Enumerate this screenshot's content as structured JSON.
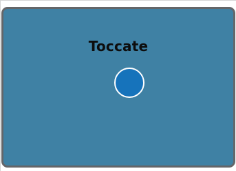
{
  "panel": {
    "title": "Toccate",
    "background_color": "#3f81a4",
    "border_color": "#646669"
  },
  "button": {
    "shape": "circle",
    "fill_color": "#1673bb",
    "ring_color": "#ffffff"
  }
}
